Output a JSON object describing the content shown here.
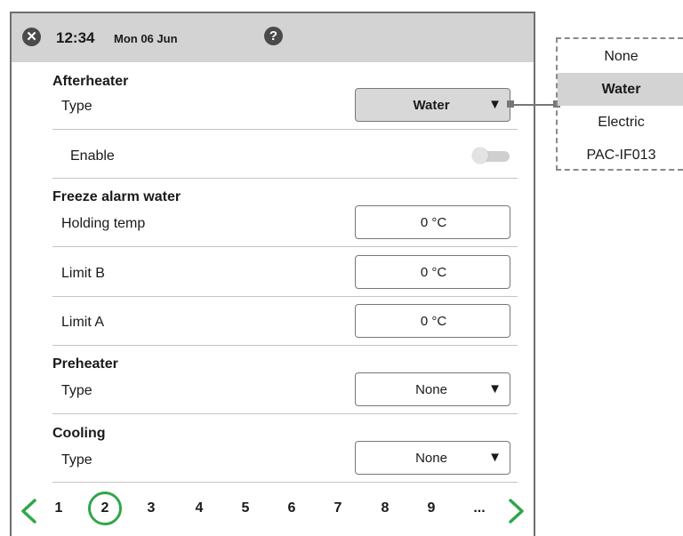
{
  "header": {
    "close_icon": "close-icon",
    "time": "12:34",
    "date": "Mon 06 Jun",
    "help_icon": "help-icon"
  },
  "afterheater": {
    "title": "Afterheater",
    "type_label": "Type",
    "type_value": "Water",
    "enable_label": "Enable",
    "enable_on": false
  },
  "freeze": {
    "title": "Freeze alarm water",
    "holding_label": "Holding temp",
    "holding_value": "0 °C",
    "limit_b_label": "Limit B",
    "limit_b_value": "0 °C",
    "limit_a_label": "Limit A",
    "limit_a_value": "0 °C"
  },
  "preheater": {
    "title": "Preheater",
    "type_label": "Type",
    "type_value": "None"
  },
  "cooling": {
    "title": "Cooling",
    "type_label": "Type",
    "type_value": "None"
  },
  "pager": {
    "pages": [
      "1",
      "2",
      "3",
      "4",
      "5",
      "6",
      "7",
      "8",
      "9",
      "..."
    ],
    "current": "2",
    "accent": "#2fa64a"
  },
  "dropdown": {
    "options": [
      "None",
      "Water",
      "Electric",
      "PAC-IF013"
    ],
    "selected": "Water"
  }
}
